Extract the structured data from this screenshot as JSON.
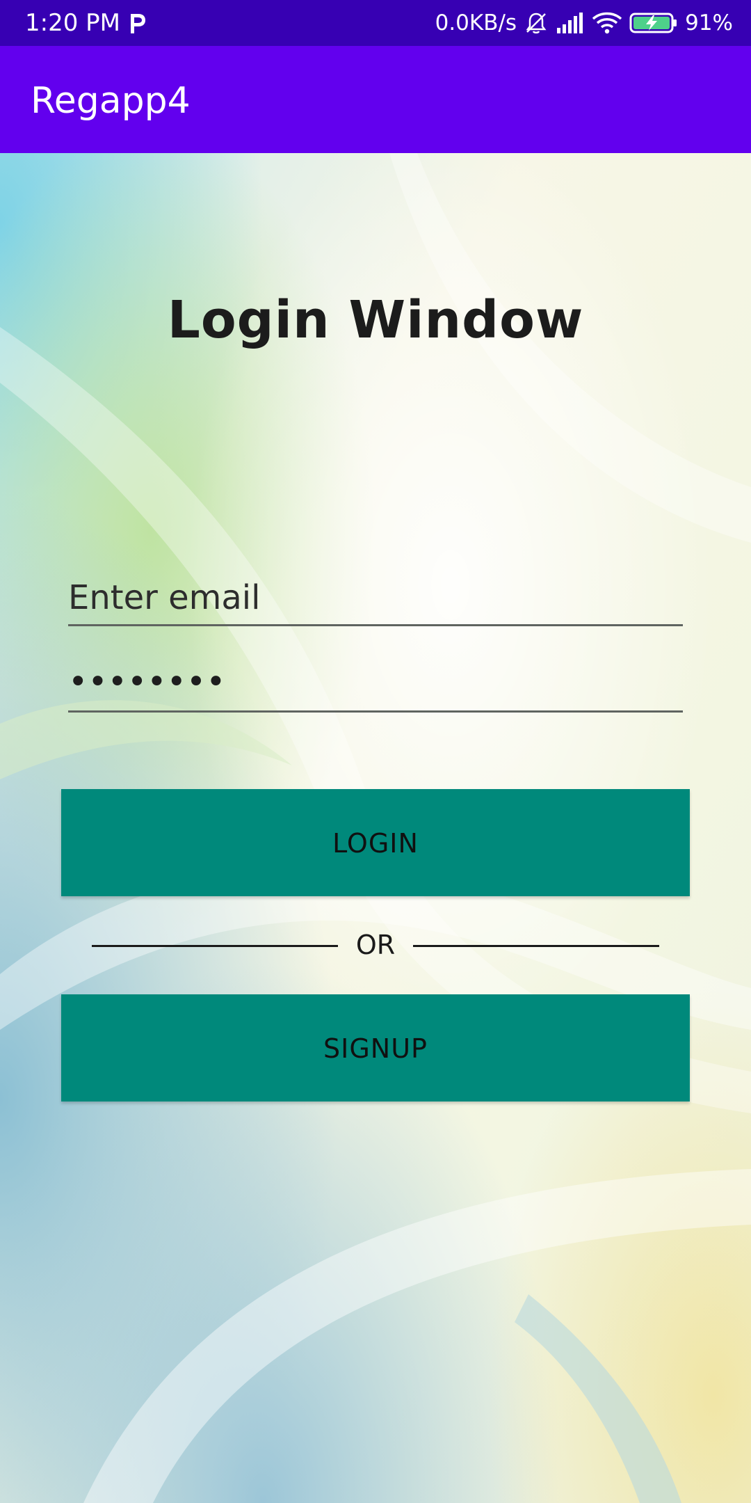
{
  "status_bar": {
    "time": "1:20 PM",
    "network_speed": "0.0KB/s",
    "battery_percent": "91%",
    "icons": [
      "parking-p-icon",
      "bell-off-icon",
      "signal-icon",
      "wifi-icon",
      "battery-charging-icon"
    ]
  },
  "app_bar": {
    "title": "Regapp4"
  },
  "login": {
    "title": "Login Window",
    "email_placeholder": "Enter email",
    "email_value": "",
    "password_masked": "••••••••",
    "login_label": "LOGIN",
    "or_label": "OR",
    "signup_label": "SIGNUP"
  },
  "colors": {
    "status_bar": "#3700b3",
    "app_bar": "#6200ee",
    "button": "#00897b"
  }
}
